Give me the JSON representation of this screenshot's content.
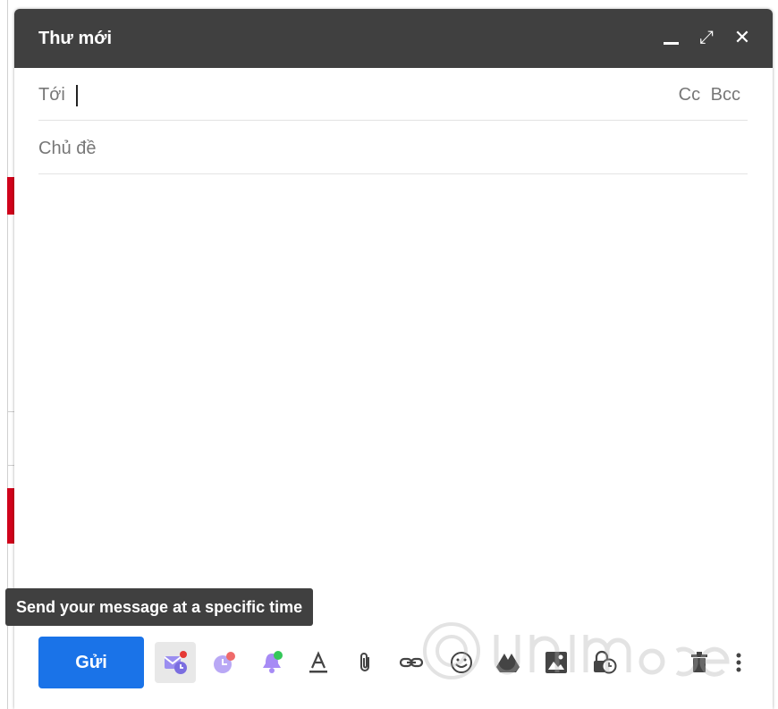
{
  "compose": {
    "title": "Thư mới",
    "to_label": "Tới",
    "cc_label": "Cc",
    "bcc_label": "Bcc",
    "subject_placeholder": "Chủ đề"
  },
  "tooltip": {
    "text": "Send your message at a specific time"
  },
  "toolbar": {
    "send_label": "Gửi",
    "icons": [
      "schedule-send-icon",
      "timer-icon",
      "reminder-bell-icon",
      "text-format-icon",
      "attach-icon",
      "link-icon",
      "emoji-icon",
      "drive-icon",
      "photo-icon",
      "confidential-mode-icon",
      "delete-icon",
      "more-options-icon"
    ]
  },
  "colors": {
    "header": "#404040",
    "send": "#1a73e8",
    "accent_purple": "#9b8ef0",
    "badge_red": "#e53935",
    "badge_green": "#34c759"
  }
}
